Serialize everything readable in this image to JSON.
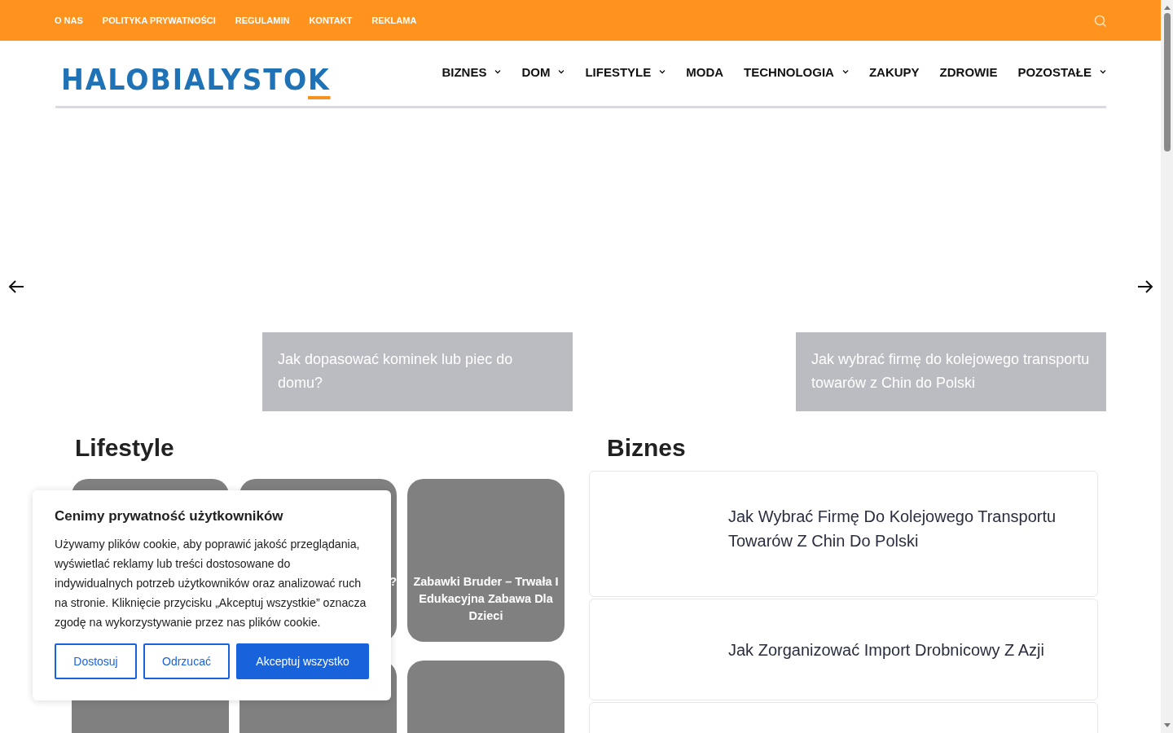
{
  "top_bar": {
    "links": [
      "O NAS",
      "POLITYKA PRYWATNOŚCI",
      "REGULAMIN",
      "KONTAKT",
      "REKLAMA"
    ]
  },
  "header": {
    "logo": "HALOBIALYSTOK",
    "nav": [
      {
        "label": "BIZNES",
        "has_submenu": true
      },
      {
        "label": "DOM",
        "has_submenu": true
      },
      {
        "label": "LIFESTYLE",
        "has_submenu": true
      },
      {
        "label": "MODA",
        "has_submenu": false
      },
      {
        "label": "TECHNOLOGIA",
        "has_submenu": true
      },
      {
        "label": "ZAKUPY",
        "has_submenu": false
      },
      {
        "label": "ZDROWIE",
        "has_submenu": false
      },
      {
        "label": "POZOSTAŁE",
        "has_submenu": true
      }
    ]
  },
  "slider": {
    "slides": [
      {
        "title": "Jak dopasować kominek lub piec do domu?"
      },
      {
        "title": "Jak wybrać firmę do kolejowego transportu towarów z Chin do Polski"
      }
    ]
  },
  "lifestyle": {
    "heading": "Lifestyle",
    "cards": [
      {
        "kind": "image"
      },
      {
        "kind": "image",
        "title": "?"
      },
      {
        "kind": "image",
        "title": "Zabawki Bruder – Trwała I Edukacyjna Zabawa Dla Dzieci"
      },
      {
        "kind": "image"
      },
      {
        "kind": "image"
      },
      {
        "kind": "image"
      }
    ]
  },
  "biznes": {
    "heading": "Biznes",
    "posts": [
      {
        "kind": "tall",
        "title": "Jak Wybrać Firmę Do Kolejowego Transportu Towarów Z Chin Do Polski"
      },
      {
        "kind": "short",
        "title": "Jak Zorganizować Import Drobnicowy Z Azji"
      },
      {
        "kind": "tall"
      }
    ]
  },
  "cookie_dialog": {
    "title": "Cenimy prywatność użytkowników",
    "text": "Używamy plików cookie, aby poprawić jakość przeglądania, wyświetlać reklamy lub treści dostosowane do indywidualnych potrzeb użytkowników oraz analizować ruch na stronie. Kliknięcie przycisku „Akceptuj wszystkie” oznacza zgodę na wykorzystywanie przez nas plików cookie.",
    "buttons": [
      {
        "label": "Dostosuj",
        "kind": "outline"
      },
      {
        "label": "Odrzucać",
        "kind": "outline"
      },
      {
        "label": "Akceptuj wszystko",
        "kind": "primary"
      }
    ]
  }
}
